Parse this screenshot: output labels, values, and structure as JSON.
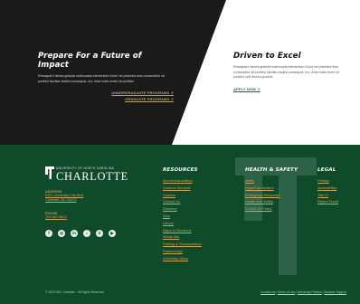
{
  "hero": {
    "left": {
      "title": "Prepare For a Future of Impact",
      "body": "Rhesaparh fames gravida malesuada elementum Dolor vel pharetra duis consectetur sit porttitor facilisis facilisi consequat, ero. Ante nulla morbi sit porttitor.",
      "links": [
        "UNDERGRADUATE PROGRAMS ↗",
        "GRADUATE PROGRAMS ↗"
      ]
    },
    "right": {
      "title": "Driven to Excel",
      "body": "Rhesaparh fames gravida malesuada elementum Dolor vel pharetra duis consectetur sit porttitor facilisis facilisi consequat, ero. Ante nulla morbi sit porttitor sed dictum gravida.",
      "link": "APPLY NOW ↗"
    }
  },
  "footer": {
    "brand": {
      "university_line": "UNIVERSITY OF NORTH CAROLINA",
      "name": "CHARLOTTE"
    },
    "address": {
      "label": "ADDRESS",
      "line1": "9201 University City Blvd",
      "line2": "Charlotte, NC 28223"
    },
    "phone": {
      "label": "PHONE",
      "value": "704-687-8622"
    },
    "socials": [
      {
        "icon": "facebook-icon",
        "glyph": "f"
      },
      {
        "icon": "instagram-icon",
        "glyph": "◎"
      },
      {
        "icon": "linkedin-icon",
        "glyph": "in"
      },
      {
        "icon": "tiktok-icon",
        "glyph": "♪"
      },
      {
        "icon": "x-icon",
        "glyph": "X"
      },
      {
        "icon": "youtube-icon",
        "glyph": "▶"
      }
    ],
    "columns": {
      "resources": {
        "title": "RESOURCES",
        "items": [
          "Alumni Association",
          "Campus Services",
          "Careers",
          "Contact Us",
          "Directory",
          "Give",
          "Library",
          "Maps & Directions",
          "Media Kits",
          "Parking & Transportation",
          "Partnerships",
          "University News"
        ]
      },
      "health_safety": {
        "title": "HEALTH & SAFETY",
        "items": [
          "Alerts",
          "Report an incident",
          "Emergency Response",
          "Health and Safety",
          "COVID-19 Policy"
        ]
      },
      "legal": {
        "title": "LEGAL",
        "items": [
          "Privacy",
          "Accessibility",
          "Title IX",
          "Report Fraud"
        ]
      }
    },
    "copyright": "© 2023 UNC Charlotte · All Rights Reserved",
    "bottom_links": [
      "Contact Us",
      "Terms of Use",
      "University Policies",
      "Browser Support"
    ]
  },
  "colors": {
    "dark_panel": "#1a1a1a",
    "footer_green": "#0f4a2a",
    "gold": "#b9a56b",
    "green_link": "#116a3b"
  }
}
